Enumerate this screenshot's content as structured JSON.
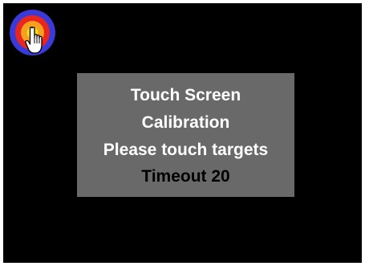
{
  "calibration": {
    "title_line1": "Touch Screen",
    "title_line2": "Calibration",
    "instruction": "Please touch targets",
    "timeout": "Timeout 20"
  },
  "target": {
    "icon": "calibration-target-with-hand-pointer-icon",
    "colors": {
      "outer_ring": "#3a3ad8",
      "middle_ring": "#e8261e",
      "inner_ring": "#f5a020",
      "center": "#f5dd10"
    }
  },
  "colors": {
    "screen_background": "#000000",
    "panel_background": "#696969",
    "panel_text": "#ffffff",
    "timeout_text": "#000000"
  }
}
